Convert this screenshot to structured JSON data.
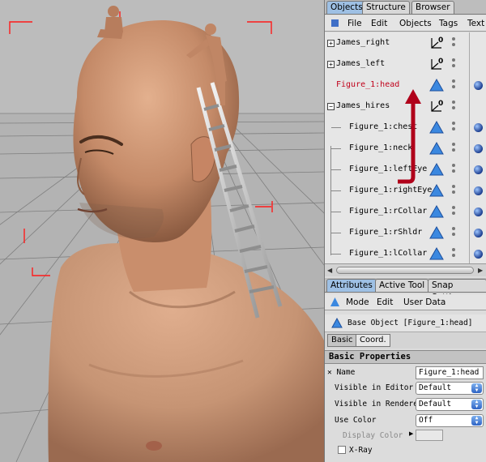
{
  "top_tabs": [
    "Objects",
    "Structure",
    "Browser"
  ],
  "objects_menu": [
    "File",
    "Edit",
    "Objects",
    "Tags",
    "Text"
  ],
  "objects": [
    {
      "name": "James_right",
      "expander": "+",
      "highlight": false,
      "type": "null-object"
    },
    {
      "name": "James_left",
      "expander": "+",
      "highlight": false,
      "type": "null-object"
    },
    {
      "name": "Figure_1:head",
      "expander": "",
      "highlight": true,
      "type": "polygon-object"
    },
    {
      "name": "James_hires",
      "expander": "−",
      "highlight": false,
      "type": "null-object"
    },
    {
      "name": "Figure_1:chest",
      "expander": "",
      "highlight": false,
      "type": "polygon-object"
    },
    {
      "name": "Figure_1:neck",
      "expander": "",
      "highlight": false,
      "type": "polygon-object"
    },
    {
      "name": "Figure_1:leftEye",
      "expander": "",
      "highlight": false,
      "type": "polygon-object"
    },
    {
      "name": "Figure_1:rightEye",
      "expander": "",
      "highlight": false,
      "type": "polygon-object"
    },
    {
      "name": "Figure_1:rCollar",
      "expander": "",
      "highlight": false,
      "type": "polygon-object"
    },
    {
      "name": "Figure_1:rShldr",
      "expander": "",
      "highlight": false,
      "type": "polygon-object"
    },
    {
      "name": "Figure_1:lCollar",
      "expander": "",
      "highlight": false,
      "type": "polygon-object"
    }
  ],
  "attr_tabs": [
    "Attributes",
    "Active Tool",
    "Snap Settings"
  ],
  "attr_menu": [
    "Mode",
    "Edit",
    "User Data"
  ],
  "base_object": "Base Object [Figure_1:head]",
  "sub_tabs": [
    "Basic",
    "Coord."
  ],
  "section_title": "Basic Properties",
  "props": {
    "name_label": "Name",
    "name_value": "Figure_1:head",
    "vis_editor_label": "Visible in Editor",
    "vis_editor_value": "Default",
    "vis_renderer_label": "Visible in Renderer",
    "vis_renderer_value": "Default",
    "use_color_label": "Use Color",
    "use_color_value": "Off",
    "display_color_label": "Display Color",
    "xray_label": "X-Ray"
  },
  "colors": {
    "selection_red": "#c0001a",
    "tab_active": "#9ec0e4",
    "arrow_red": "#b0001a"
  }
}
